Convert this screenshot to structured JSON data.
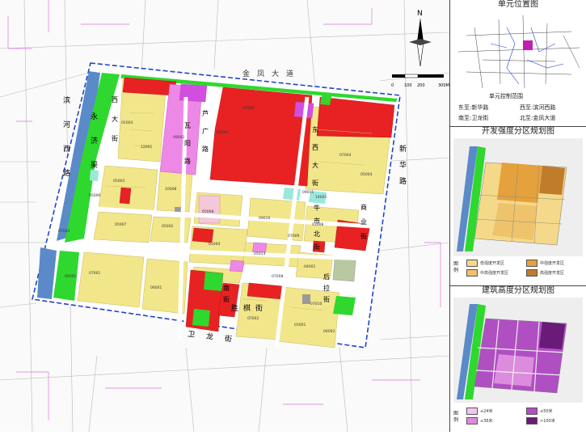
{
  "map": {
    "roads": {
      "north": "金凤大道",
      "west": [
        "滨",
        "河",
        "西",
        "路"
      ],
      "east": [
        "新",
        "华",
        "路"
      ],
      "canal": [
        "永",
        "济",
        "渠"
      ],
      "south": [
        "卫",
        "龙",
        "街"
      ],
      "mid_vertical": [
        "瓦",
        "阳",
        "路"
      ],
      "mid_vertical2": [
        "东",
        "西",
        "大",
        "街"
      ],
      "mid_street": [
        "牛",
        "市",
        "北",
        "街"
      ],
      "mid_street2": [
        "后",
        "拉",
        "街"
      ],
      "west_mid": [
        "西",
        "大",
        "街"
      ],
      "north_street": [
        "芦",
        "广",
        "路"
      ],
      "south_street": [
        "胜",
        "棋",
        "街"
      ],
      "small_street": [
        "南",
        "街"
      ],
      "east_street": [
        "商",
        "业",
        "街"
      ]
    },
    "scale": {
      "labels": [
        "0",
        "100",
        "200",
        "300M"
      ]
    },
    "parcel_codes": [
      "09002",
      "12001",
      "05003",
      "10008",
      "05007",
      "05002",
      "07001",
      "06001",
      "01004",
      "09010",
      "01008",
      "05013",
      "04001",
      "07002",
      "01001",
      "04002",
      "07006",
      "07004",
      "05004",
      "05008",
      "01003",
      "05006",
      "07003",
      "05001",
      "09011",
      "14001",
      "01002",
      "07008",
      "07009",
      "07010"
    ]
  },
  "side": {
    "location_title": "单元位置图",
    "unit_scope": "单元控制范围",
    "bounds": {
      "east_label": "东至:",
      "east_value": "新华路",
      "west_label": "西至:",
      "west_value": "滨河西路",
      "south_label": "南至:",
      "south_value": "卫龙街",
      "north_label": "北至:",
      "north_value": "金凤大道"
    },
    "intensity_title": "开发强度分区规划图",
    "intensity_legend_label": "图例",
    "intensity_legend": [
      {
        "label": "低强度开发区",
        "color": "#f5d98a"
      },
      {
        "label": "中强度开发区",
        "color": "#e4a13c"
      },
      {
        "label": "中高强度开发区",
        "color": "#eec36a"
      },
      {
        "label": "高强度开发区",
        "color": "#c07c2a"
      }
    ],
    "height_title": "建筑高度分区规划图",
    "height_legend_label": "图例",
    "height_legend": [
      {
        "label": "≤24米",
        "color": "#f2c6f2"
      },
      {
        "label": "≤50米",
        "color": "#b04fc2"
      },
      {
        "label": "≤36米",
        "color": "#dc8cdc"
      },
      {
        "label": ">100米",
        "color": "#6a1a78"
      }
    ]
  },
  "colors": {
    "residential": "#f2e68a",
    "commercial": "#e82222",
    "green": "#2ed82e",
    "water": "#5a8ac8",
    "cultural": "#ee88e6",
    "boundary": "#2244cc"
  }
}
